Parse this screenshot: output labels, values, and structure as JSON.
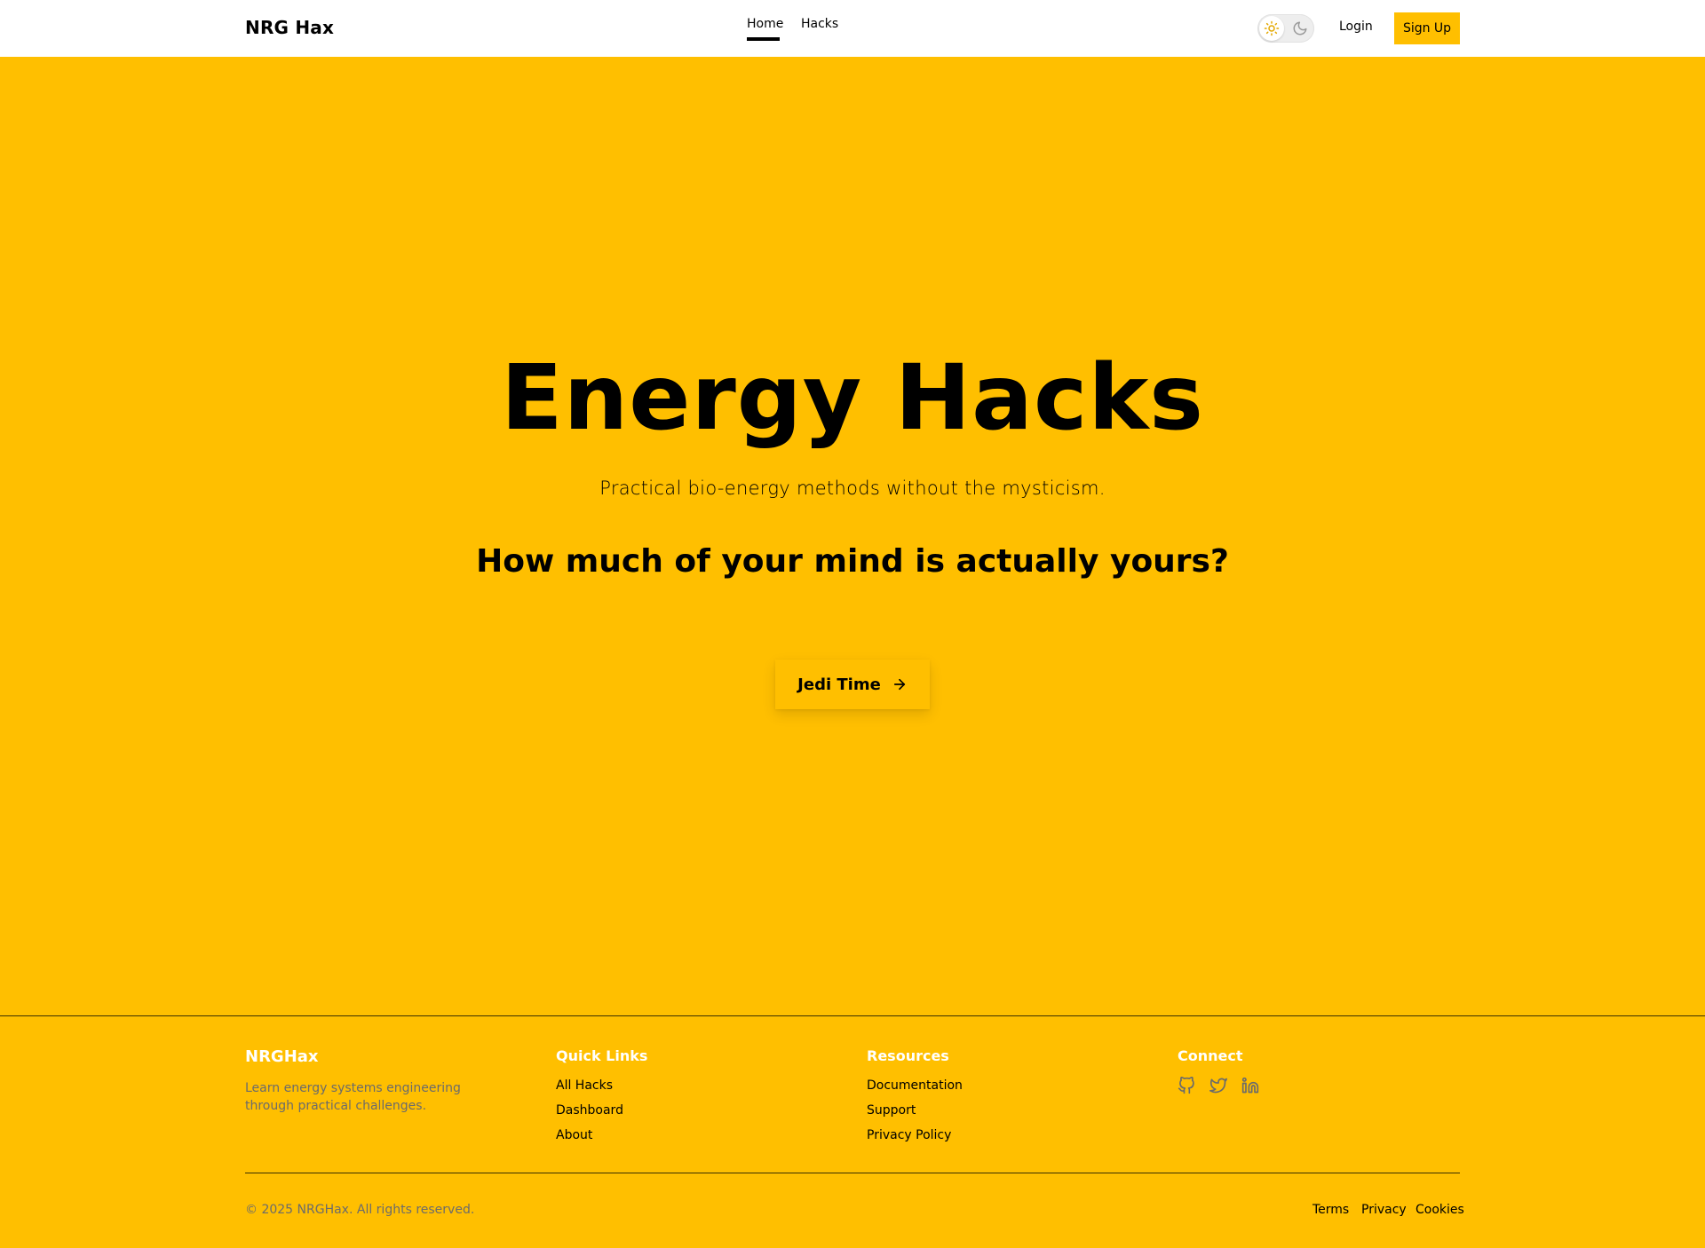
{
  "navbar": {
    "brand": "NRG Hax",
    "links": [
      {
        "label": "Home",
        "active": true
      },
      {
        "label": "Hacks",
        "active": false
      }
    ],
    "theme_toggle": {
      "mode": "light",
      "sun_icon": "sun-icon",
      "moon_icon": "moon-icon"
    },
    "login_label": "Login",
    "signup_label": "Sign Up"
  },
  "hero": {
    "title": "Energy Hacks",
    "subtitle": "Practical bio-energy methods without the mysticism.",
    "question": "How much of your mind is actually yours?",
    "cta_label": "Jedi Time",
    "cta_icon": "arrow-right-icon"
  },
  "footer": {
    "brand": "NRGHax",
    "tagline": "Learn energy systems engineering through practical challenges.",
    "quick_links": {
      "heading": "Quick Links",
      "items": [
        "All Hacks",
        "Dashboard",
        "About"
      ]
    },
    "resources": {
      "heading": "Resources",
      "items": [
        "Documentation",
        "Support",
        "Privacy Policy"
      ]
    },
    "connect": {
      "heading": "Connect",
      "icons": [
        "github-icon",
        "twitter-icon",
        "linkedin-icon"
      ]
    },
    "copyright": "© 2025 NRGHax. All rights reserved.",
    "legal": [
      "Terms",
      "Privacy",
      "Cookies"
    ]
  },
  "colors": {
    "accent": "#FFBF00",
    "nav_background": "#FFFFFF",
    "text": "#000000",
    "muted_text": "#6B6B6B",
    "footer_heading": "#FFFFFF"
  }
}
